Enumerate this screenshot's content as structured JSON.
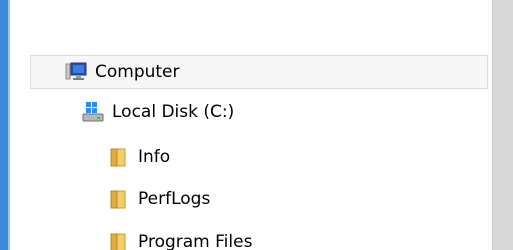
{
  "tree": {
    "items": [
      {
        "label": "Computer",
        "icon": "computer-icon",
        "selected": true
      },
      {
        "label": "Local Disk (C:)",
        "icon": "drive-icon"
      },
      {
        "label": "Info",
        "icon": "folder-icon"
      },
      {
        "label": "PerfLogs",
        "icon": "folder-icon"
      },
      {
        "label": "Program Files",
        "icon": "folder-icon"
      }
    ]
  },
  "colors": {
    "accent": "#3c8bd9",
    "selection_border": "#dadada",
    "selection_bg": "#f7f7f7",
    "scrollbar": "#d9d9d9",
    "folder": "#e8b84a"
  }
}
